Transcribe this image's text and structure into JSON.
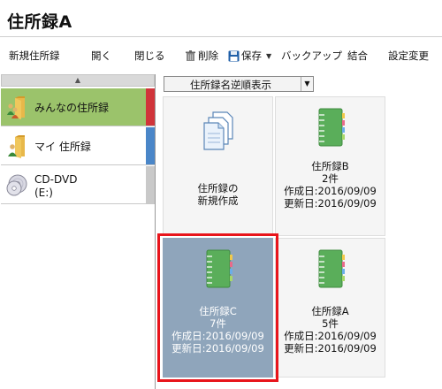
{
  "window": {
    "title": "住所録A"
  },
  "toolbar": {
    "new": "新規住所録",
    "open": "開く",
    "close": "閉じる",
    "delete": "削除",
    "save": "保存",
    "backup": "バックアップ",
    "merge": "結合",
    "settings": "設定変更"
  },
  "sidebar": {
    "items": [
      {
        "label": "みんなの住所録",
        "icon": "folder-people-icon",
        "color": "#d0343a"
      },
      {
        "label": "マイ 住所録",
        "icon": "folder-person-icon",
        "color": "#4a86c8"
      },
      {
        "label_line1": "CD-DVD",
        "label_line2": "(E:)",
        "icon": "cd-dvd-icon",
        "color": "#c9c9c9"
      }
    ]
  },
  "sort": {
    "selected": "住所録名逆順表示"
  },
  "cards": [
    {
      "line1": "住所録の",
      "line2": "新規作成",
      "icon": "new-documents-icon"
    },
    {
      "name": "住所録B",
      "count": "2件",
      "created": "作成日:2016/09/09",
      "updated": "更新日:2016/09/09",
      "icon": "address-book-icon"
    },
    {
      "name": "住所録C",
      "count": "7件",
      "created": "作成日:2016/09/09",
      "updated": "更新日:2016/09/09",
      "icon": "address-book-icon",
      "selected": true
    },
    {
      "name": "住所録A",
      "count": "5件",
      "created": "作成日:2016/09/09",
      "updated": "更新日:2016/09/09",
      "icon": "address-book-icon"
    }
  ],
  "colors": {
    "selected_nav": "#9bc36b",
    "selected_card": "#8fa5bb",
    "highlight": "#e8141b",
    "book_green": "#5aae5a"
  }
}
